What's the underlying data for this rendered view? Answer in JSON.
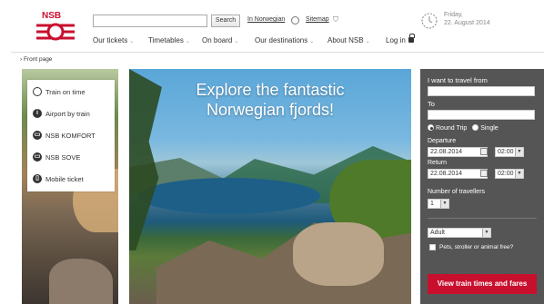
{
  "brand": {
    "logo_text": "NSB",
    "accent": "#c8102e"
  },
  "header": {
    "search_button": "Search",
    "language_link": "In Norwegian",
    "sitemap_link": "Sitemap",
    "date_weekday": "Friday,",
    "date_full": "22. August 2014"
  },
  "nav": [
    {
      "label": "Our tickets"
    },
    {
      "label": "Timetables"
    },
    {
      "label": "On board"
    },
    {
      "label": "Our destinations"
    },
    {
      "label": "About NSB"
    }
  ],
  "login_label": "Log in",
  "breadcrumb": "Front page",
  "menu": [
    {
      "label": "Train on time",
      "icon": "clock-icon"
    },
    {
      "label": "Airport by train",
      "icon": "info-icon"
    },
    {
      "label": "NSB KOMFORT",
      "icon": "train-icon"
    },
    {
      "label": "NSB SOVE",
      "icon": "train-icon"
    },
    {
      "label": "Mobile ticket",
      "icon": "mobile-icon"
    }
  ],
  "hero": {
    "line1": "Explore the fantastic",
    "line2": "Norwegian fjords!"
  },
  "booking": {
    "from_label": "I want to travel from",
    "to_label": "To",
    "round_trip": "Round Trip",
    "single": "Single",
    "departure_label": "Departure",
    "departure_date": "22.08.2014",
    "departure_time": "02:00",
    "return_label": "Return",
    "return_date": "22.08.2014",
    "return_time": "02:00",
    "travellers_label": "Number of travellers",
    "travellers_count": "1",
    "passenger_type": "Adult",
    "extra_label": "Pets, stroller or animal free?",
    "cta": "View train times and fares"
  }
}
